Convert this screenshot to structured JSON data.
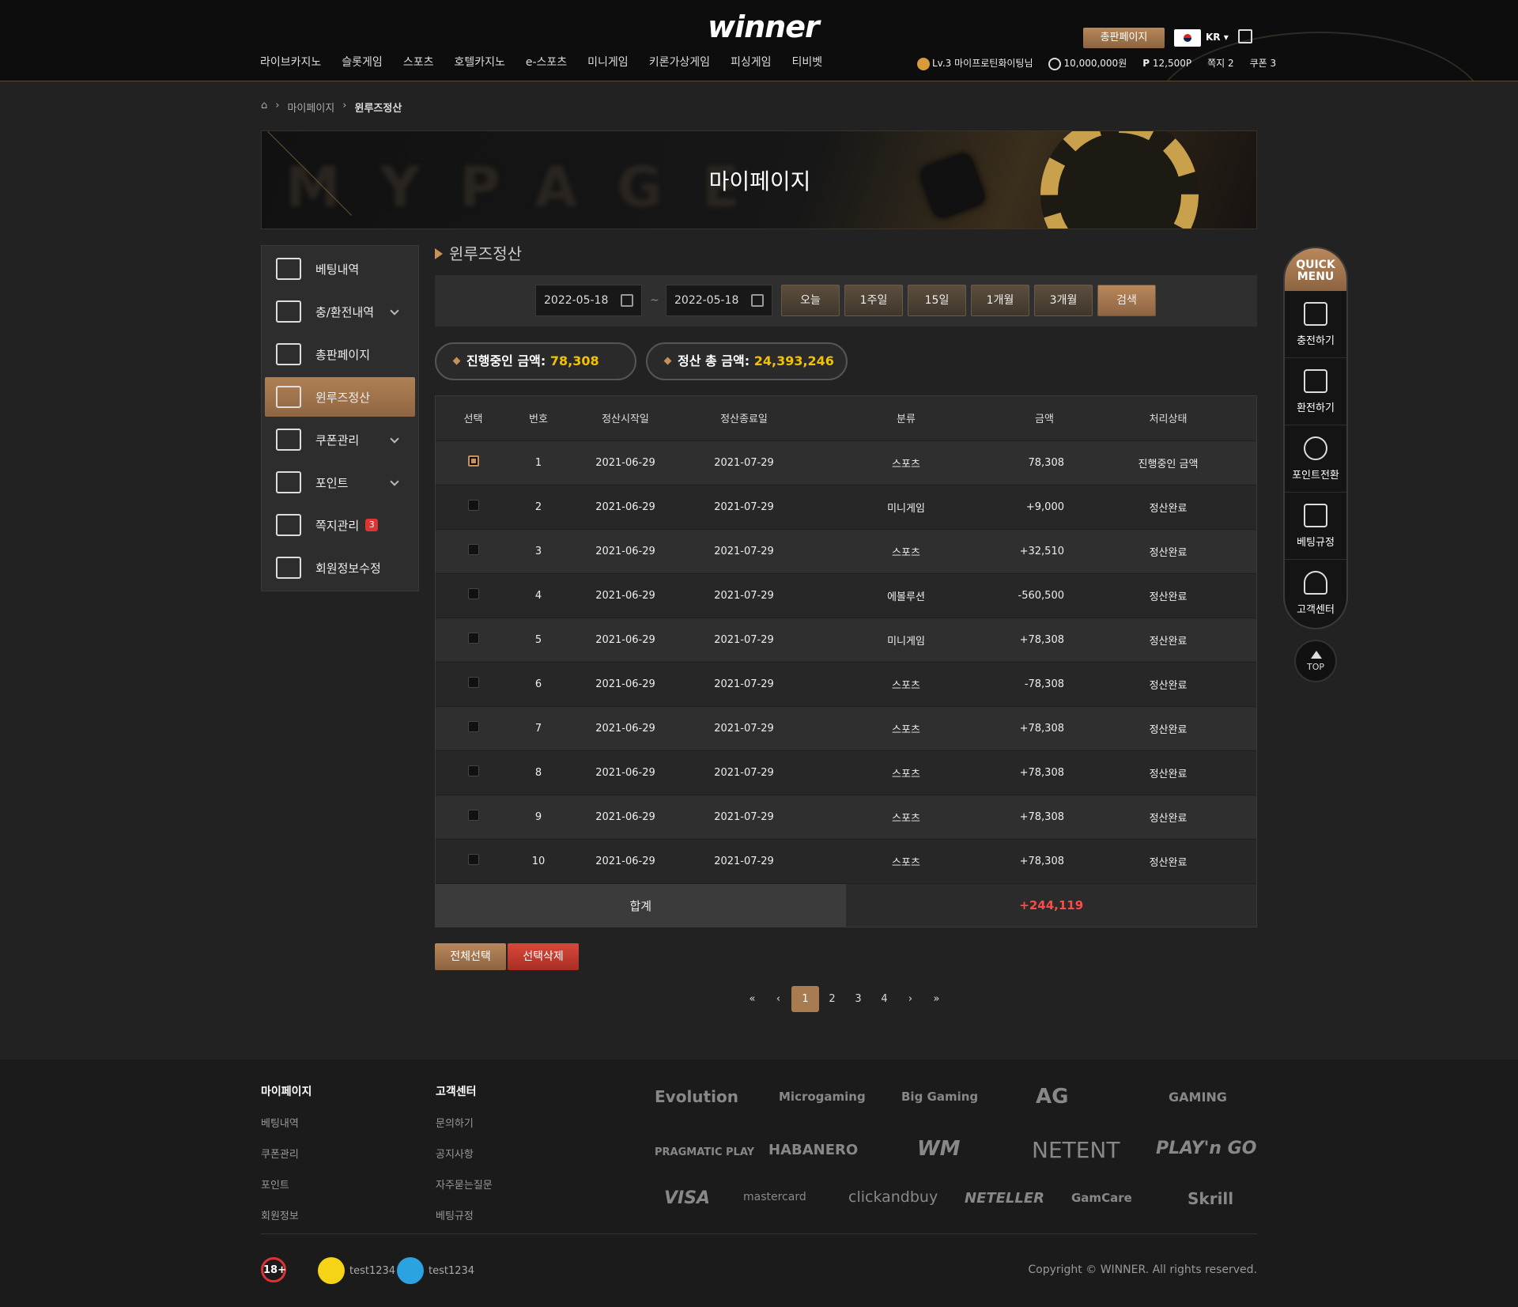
{
  "header": {
    "logo": "winner",
    "nav": [
      "라이브카지노",
      "슬롯게임",
      "스포츠",
      "호텔카지노",
      "e-스포츠",
      "미니게임",
      "키론가상게임",
      "피싱게임",
      "티비벳"
    ],
    "distributor_button": "총판페이지",
    "language": "KR",
    "user": {
      "level_name": "Lv.3 마이프로틴화이팅님",
      "money": "10,000,000원",
      "points": "12,500P",
      "messages": "쪽지 2",
      "coupons": "쿠폰 3"
    }
  },
  "breadcrumb": [
    "마이페이지",
    "윈루즈정산"
  ],
  "banner": {
    "title": "마이페이지",
    "bg_text": "MYPAGE"
  },
  "sidebar": {
    "items": [
      {
        "label": "베팅내역"
      },
      {
        "label": "충/환전내역"
      },
      {
        "label": "총판페이지"
      },
      {
        "label": "윈루즈정산"
      },
      {
        "label": "쿠폰관리"
      },
      {
        "label": "포인트"
      },
      {
        "label": "쪽지관리",
        "badge": "3"
      },
      {
        "label": "회원정보수정"
      }
    ],
    "active": "윈루즈정산"
  },
  "section_title": "윈루즈정산",
  "filter": {
    "date_from": "2022-05-18",
    "date_to": "2022-05-18",
    "separator": "~",
    "buttons": [
      "오늘",
      "1주일",
      "15일",
      "1개월",
      "3개월"
    ],
    "search_label": "검색"
  },
  "summary": {
    "in_progress_label": "진행중인 금액:",
    "in_progress_value": "78,308",
    "total_label": "정산 총 금액:",
    "total_value": "24,393,246"
  },
  "table": {
    "headers": [
      "선택",
      "번호",
      "정산시작일",
      "정산종료일",
      "분류",
      "금액",
      "처리상태"
    ],
    "rows": [
      {
        "no": "1",
        "start": "2021-06-29",
        "end": "2021-07-29",
        "category": "스포츠",
        "amount": "78,308",
        "status": "진행중인 금액",
        "tone": "plain",
        "checked": true
      },
      {
        "no": "2",
        "start": "2021-06-29",
        "end": "2021-07-29",
        "category": "미니게임",
        "amount": "+9,000",
        "status": "정산완료",
        "tone": "red",
        "checked": false
      },
      {
        "no": "3",
        "start": "2021-06-29",
        "end": "2021-07-29",
        "category": "스포츠",
        "amount": "+32,510",
        "status": "정산완료",
        "tone": "red",
        "checked": false
      },
      {
        "no": "4",
        "start": "2021-06-29",
        "end": "2021-07-29",
        "category": "에볼루션",
        "amount": "-560,500",
        "status": "정산완료",
        "tone": "blue",
        "checked": false
      },
      {
        "no": "5",
        "start": "2021-06-29",
        "end": "2021-07-29",
        "category": "미니게임",
        "amount": "+78,308",
        "status": "정산완료",
        "tone": "red",
        "checked": false
      },
      {
        "no": "6",
        "start": "2021-06-29",
        "end": "2021-07-29",
        "category": "스포츠",
        "amount": "-78,308",
        "status": "정산완료",
        "tone": "blue",
        "checked": false
      },
      {
        "no": "7",
        "start": "2021-06-29",
        "end": "2021-07-29",
        "category": "스포츠",
        "amount": "+78,308",
        "status": "정산완료",
        "tone": "red",
        "checked": false
      },
      {
        "no": "8",
        "start": "2021-06-29",
        "end": "2021-07-29",
        "category": "스포츠",
        "amount": "+78,308",
        "status": "정산완료",
        "tone": "red",
        "checked": false
      },
      {
        "no": "9",
        "start": "2021-06-29",
        "end": "2021-07-29",
        "category": "스포츠",
        "amount": "+78,308",
        "status": "정산완료",
        "tone": "red",
        "checked": false
      },
      {
        "no": "10",
        "start": "2021-06-29",
        "end": "2021-07-29",
        "category": "스포츠",
        "amount": "+78,308",
        "status": "정산완료",
        "tone": "red",
        "checked": false
      }
    ],
    "total_label": "합계",
    "total_value": "+244,119"
  },
  "actions": {
    "select_all": "전체선택",
    "delete_selected": "선택삭제"
  },
  "pagination": {
    "pages": [
      "1",
      "2",
      "3",
      "4"
    ],
    "current": "1",
    "first": "«",
    "prev": "‹",
    "next": "›",
    "last": "»"
  },
  "quick_menu": {
    "title_line1": "QUICK",
    "title_line2": "MENU",
    "items": [
      "충전하기",
      "환전하기",
      "포인트전환",
      "베팅규정",
      "고객센터"
    ],
    "top": "TOP"
  },
  "footer": {
    "col1": {
      "title": "마이페이지",
      "links": [
        "베팅내역",
        "쿠폰관리",
        "포인트",
        "회원정보"
      ]
    },
    "col2": {
      "title": "고객센터",
      "links": [
        "문의하기",
        "공지사항",
        "자주묻는질문",
        "베팅규정"
      ]
    },
    "providers": [
      "Evolution",
      "Microgaming",
      "Big Gaming",
      "AG",
      "GAMING",
      "PRAGMATIC PLAY",
      "HABANERO",
      "WM",
      "NETENT",
      "PLAY'n GO",
      "VISA",
      "mastercard",
      "clickandbuy",
      "NETELLER",
      "GamCare",
      "Skrill"
    ],
    "age": "18+",
    "kakao": "test1234",
    "telegram": "test1234",
    "copyright": "Copyright © WINNER. All rights reserved."
  },
  "colors": {
    "accent": "#b08054",
    "positive": "#ff4a4a",
    "negative": "#4a8cff",
    "highlight": "#f2c200"
  }
}
